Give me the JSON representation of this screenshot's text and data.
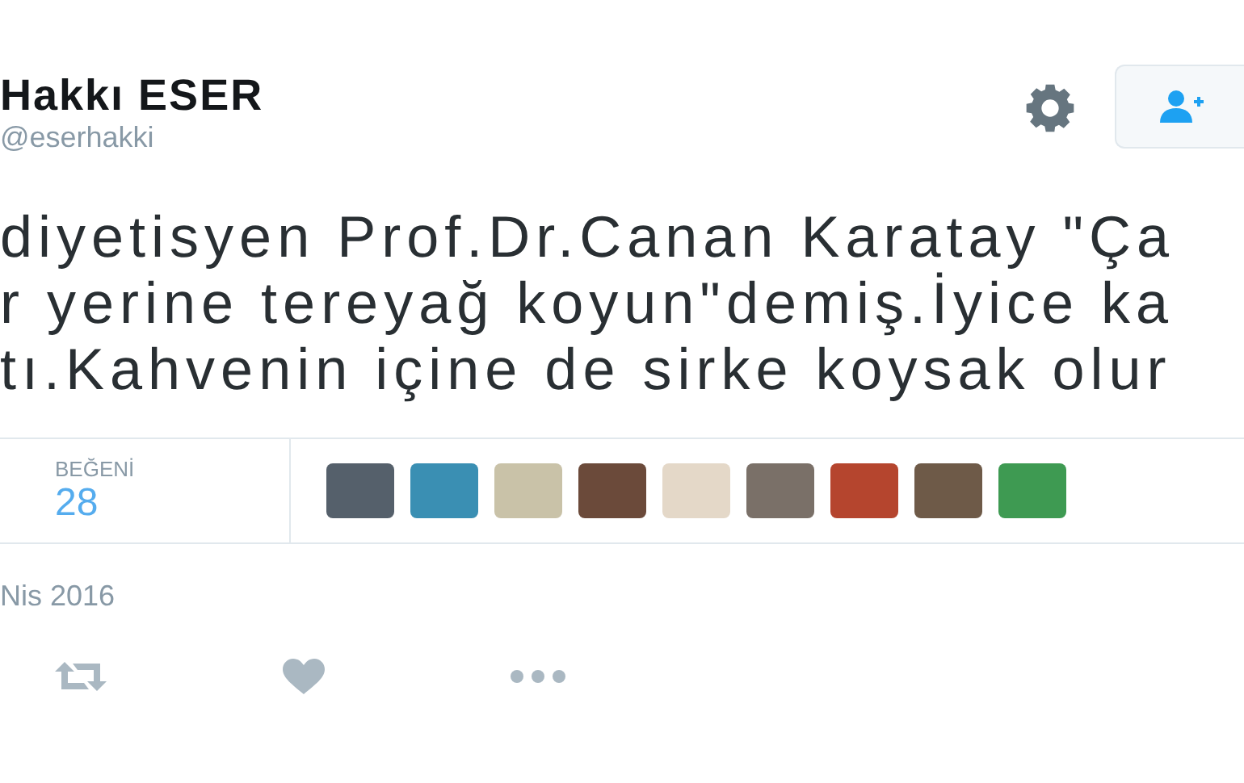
{
  "author": {
    "name": "Hakkı ESER",
    "handle": "@eserhakki"
  },
  "tweet_lines": [
    "diyetisyen Prof.Dr.Canan Karatay \"Ça",
    "r yerine tereyağ koyun\"demiş.İyice ka",
    "tı.Kahvenin içine de sirke koysak olur"
  ],
  "stats": {
    "label": "BEĞENİ",
    "count": "28",
    "likers": [
      {
        "color": "#55606b"
      },
      {
        "color": "#3a8fb3"
      },
      {
        "color": "#c9c2a8"
      },
      {
        "color": "#6b4a3a"
      },
      {
        "color": "#e4d8c8"
      },
      {
        "color": "#7a7068"
      },
      {
        "color": "#b5452e"
      },
      {
        "color": "#6e5a48"
      },
      {
        "color": "#3e9a52"
      }
    ]
  },
  "date": "Nis 2016"
}
